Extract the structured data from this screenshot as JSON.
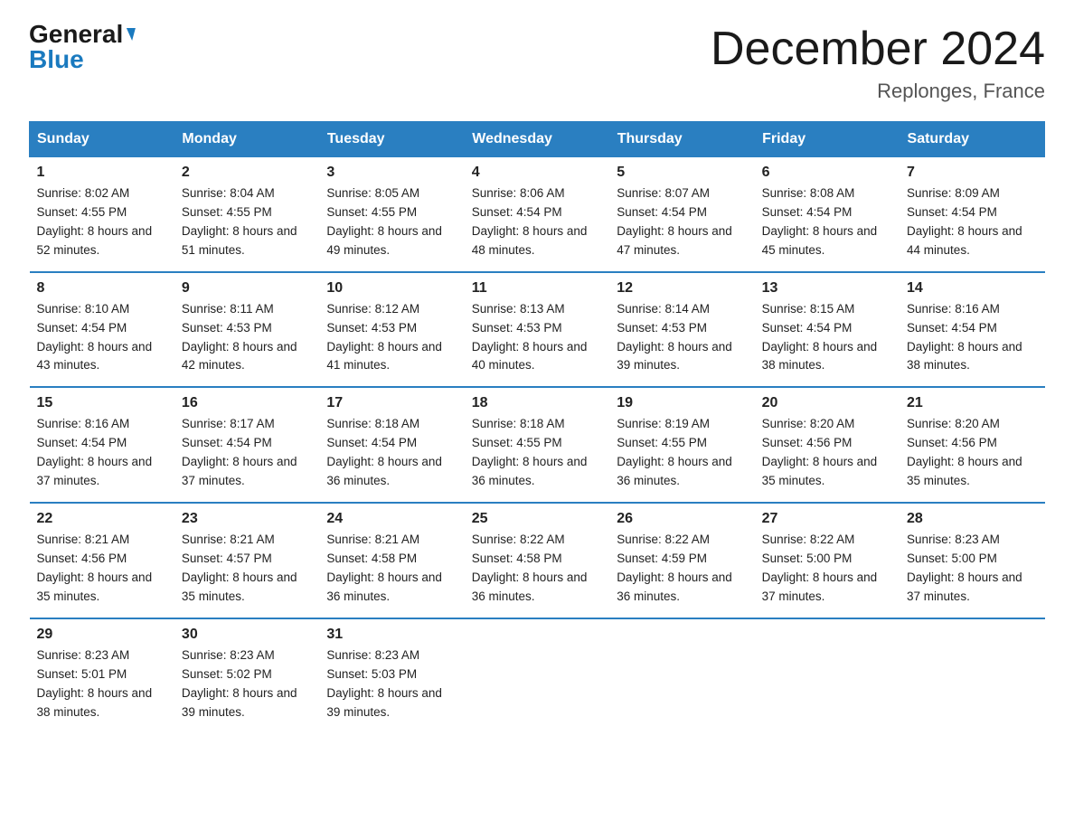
{
  "header": {
    "logo_general": "General",
    "logo_blue": "Blue",
    "month_title": "December 2024",
    "location": "Replonges, France"
  },
  "weekdays": [
    "Sunday",
    "Monday",
    "Tuesday",
    "Wednesday",
    "Thursday",
    "Friday",
    "Saturday"
  ],
  "weeks": [
    [
      {
        "day": "1",
        "sunrise": "8:02 AM",
        "sunset": "4:55 PM",
        "daylight": "8 hours and 52 minutes."
      },
      {
        "day": "2",
        "sunrise": "8:04 AM",
        "sunset": "4:55 PM",
        "daylight": "8 hours and 51 minutes."
      },
      {
        "day": "3",
        "sunrise": "8:05 AM",
        "sunset": "4:55 PM",
        "daylight": "8 hours and 49 minutes."
      },
      {
        "day": "4",
        "sunrise": "8:06 AM",
        "sunset": "4:54 PM",
        "daylight": "8 hours and 48 minutes."
      },
      {
        "day": "5",
        "sunrise": "8:07 AM",
        "sunset": "4:54 PM",
        "daylight": "8 hours and 47 minutes."
      },
      {
        "day": "6",
        "sunrise": "8:08 AM",
        "sunset": "4:54 PM",
        "daylight": "8 hours and 45 minutes."
      },
      {
        "day": "7",
        "sunrise": "8:09 AM",
        "sunset": "4:54 PM",
        "daylight": "8 hours and 44 minutes."
      }
    ],
    [
      {
        "day": "8",
        "sunrise": "8:10 AM",
        "sunset": "4:54 PM",
        "daylight": "8 hours and 43 minutes."
      },
      {
        "day": "9",
        "sunrise": "8:11 AM",
        "sunset": "4:53 PM",
        "daylight": "8 hours and 42 minutes."
      },
      {
        "day": "10",
        "sunrise": "8:12 AM",
        "sunset": "4:53 PM",
        "daylight": "8 hours and 41 minutes."
      },
      {
        "day": "11",
        "sunrise": "8:13 AM",
        "sunset": "4:53 PM",
        "daylight": "8 hours and 40 minutes."
      },
      {
        "day": "12",
        "sunrise": "8:14 AM",
        "sunset": "4:53 PM",
        "daylight": "8 hours and 39 minutes."
      },
      {
        "day": "13",
        "sunrise": "8:15 AM",
        "sunset": "4:54 PM",
        "daylight": "8 hours and 38 minutes."
      },
      {
        "day": "14",
        "sunrise": "8:16 AM",
        "sunset": "4:54 PM",
        "daylight": "8 hours and 38 minutes."
      }
    ],
    [
      {
        "day": "15",
        "sunrise": "8:16 AM",
        "sunset": "4:54 PM",
        "daylight": "8 hours and 37 minutes."
      },
      {
        "day": "16",
        "sunrise": "8:17 AM",
        "sunset": "4:54 PM",
        "daylight": "8 hours and 37 minutes."
      },
      {
        "day": "17",
        "sunrise": "8:18 AM",
        "sunset": "4:54 PM",
        "daylight": "8 hours and 36 minutes."
      },
      {
        "day": "18",
        "sunrise": "8:18 AM",
        "sunset": "4:55 PM",
        "daylight": "8 hours and 36 minutes."
      },
      {
        "day": "19",
        "sunrise": "8:19 AM",
        "sunset": "4:55 PM",
        "daylight": "8 hours and 36 minutes."
      },
      {
        "day": "20",
        "sunrise": "8:20 AM",
        "sunset": "4:56 PM",
        "daylight": "8 hours and 35 minutes."
      },
      {
        "day": "21",
        "sunrise": "8:20 AM",
        "sunset": "4:56 PM",
        "daylight": "8 hours and 35 minutes."
      }
    ],
    [
      {
        "day": "22",
        "sunrise": "8:21 AM",
        "sunset": "4:56 PM",
        "daylight": "8 hours and 35 minutes."
      },
      {
        "day": "23",
        "sunrise": "8:21 AM",
        "sunset": "4:57 PM",
        "daylight": "8 hours and 35 minutes."
      },
      {
        "day": "24",
        "sunrise": "8:21 AM",
        "sunset": "4:58 PM",
        "daylight": "8 hours and 36 minutes."
      },
      {
        "day": "25",
        "sunrise": "8:22 AM",
        "sunset": "4:58 PM",
        "daylight": "8 hours and 36 minutes."
      },
      {
        "day": "26",
        "sunrise": "8:22 AM",
        "sunset": "4:59 PM",
        "daylight": "8 hours and 36 minutes."
      },
      {
        "day": "27",
        "sunrise": "8:22 AM",
        "sunset": "5:00 PM",
        "daylight": "8 hours and 37 minutes."
      },
      {
        "day": "28",
        "sunrise": "8:23 AM",
        "sunset": "5:00 PM",
        "daylight": "8 hours and 37 minutes."
      }
    ],
    [
      {
        "day": "29",
        "sunrise": "8:23 AM",
        "sunset": "5:01 PM",
        "daylight": "8 hours and 38 minutes."
      },
      {
        "day": "30",
        "sunrise": "8:23 AM",
        "sunset": "5:02 PM",
        "daylight": "8 hours and 39 minutes."
      },
      {
        "day": "31",
        "sunrise": "8:23 AM",
        "sunset": "5:03 PM",
        "daylight": "8 hours and 39 minutes."
      },
      null,
      null,
      null,
      null
    ]
  ]
}
